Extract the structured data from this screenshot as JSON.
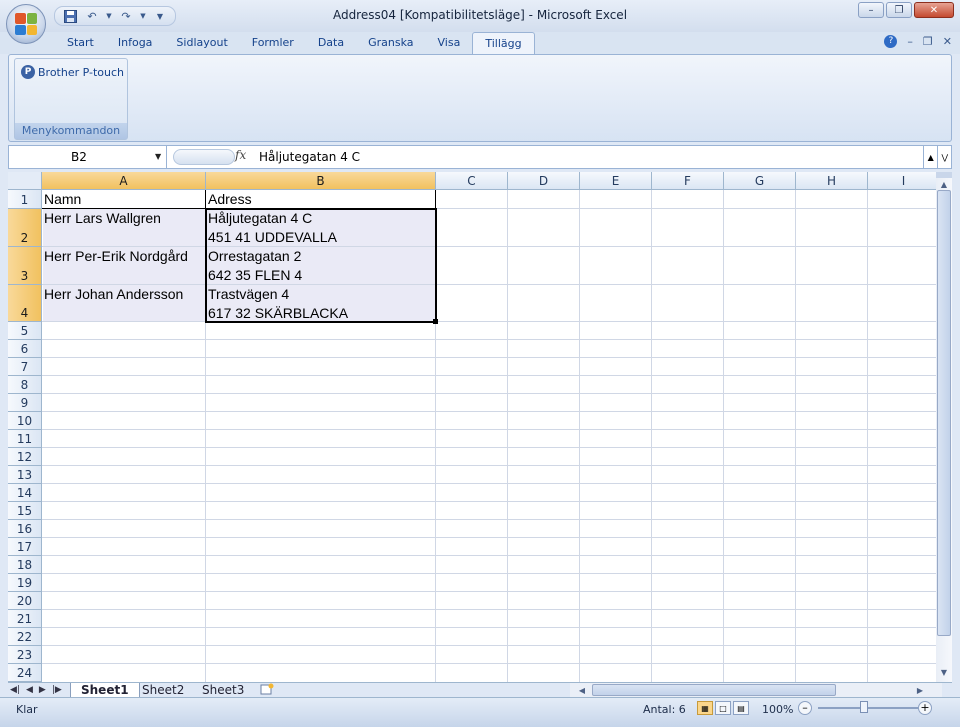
{
  "window": {
    "title": "Address04  [Kompatibilitetsläge] - Microsoft Excel",
    "controls": [
      "minimize",
      "restore",
      "close"
    ]
  },
  "quick_access": {
    "icons": [
      "save-icon",
      "undo-icon",
      "redo-icon",
      "customize-icon"
    ]
  },
  "ribbon": {
    "tabs": [
      "Start",
      "Infoga",
      "Sidlayout",
      "Formler",
      "Data",
      "Granska",
      "Visa",
      "Tillägg"
    ],
    "active_tab": "Tillägg",
    "group": {
      "button_label": "Brother P-touch",
      "group_label": "Menykommandon"
    }
  },
  "formula_bar": {
    "name_box": "B2",
    "fx_label": "fx",
    "content": "Håljutegatan 4 C"
  },
  "columns": [
    "A",
    "B",
    "C",
    "D",
    "E",
    "F",
    "G",
    "H",
    "I"
  ],
  "rows": [
    "1",
    "2",
    "3",
    "4",
    "5",
    "6",
    "7",
    "8",
    "9",
    "10",
    "11",
    "12",
    "13",
    "14",
    "15",
    "16",
    "17",
    "18",
    "19",
    "20",
    "21",
    "22",
    "23",
    "24"
  ],
  "cells": {
    "A1": "Namn",
    "B1": "Adress",
    "A2": "Herr Lars Wallgren",
    "B2_line1": "Håljutegatan 4 C",
    "B2_line2": "451 41 UDDEVALLA",
    "A3": "Herr Per-Erik Nordgård",
    "B3_line1": "Orrestagatan 2",
    "B3_line2": "642 35 FLEN 4",
    "A4": "Herr Johan Andersson",
    "B4_line1": "Trastvägen 4",
    "B4_line2": "617 32 SKÄRBLACKA"
  },
  "sheets": [
    "Sheet1",
    "Sheet2",
    "Sheet3"
  ],
  "active_sheet": "Sheet1",
  "status": {
    "ready": "Klar",
    "count": "Antal: 6",
    "zoom": "100%"
  },
  "colors": {
    "selection_header": "#f1c15f",
    "selection_fill": "#eaeaf6",
    "ribbon_text": "#15428b"
  }
}
